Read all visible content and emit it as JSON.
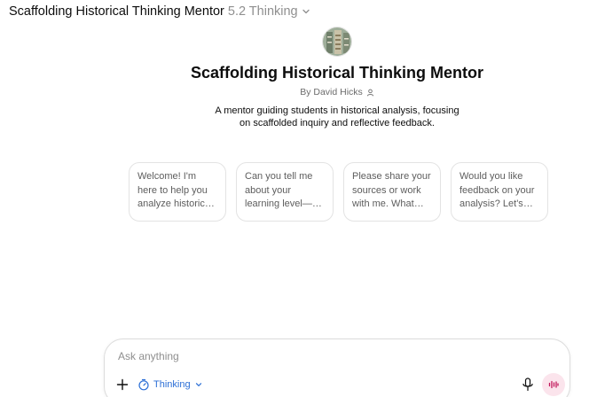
{
  "header": {
    "title": "Scaffolding Historical Thinking Mentor",
    "model": "5.2 Thinking",
    "chevron_icon": "chevron-down-icon"
  },
  "gpt": {
    "avatar_icon": "gpt-avatar-image",
    "title": "Scaffolding Historical Thinking Mentor",
    "author": "By David Hicks",
    "author_icon": "person-icon",
    "description": "A mentor guiding students in historical analysis, focusing on scaffolded inquiry and reflective feedback."
  },
  "starters": [
    {
      "text": "Welcome! I'm here to help you analyze historical sources..."
    },
    {
      "text": "Can you tell me about your learning level—are you in..."
    },
    {
      "text": "Please share your sources or work with me. What do..."
    },
    {
      "text": "Would you like feedback on your analysis? Let's se..."
    }
  ],
  "composer": {
    "placeholder": "Ask anything",
    "mode_label": "Thinking",
    "plus_icon": "plus-icon",
    "mode_icon": "timer-icon",
    "mic_icon": "microphone-icon",
    "voice_icon": "voice-waveform-icon"
  },
  "colors": {
    "accent": "#2c6fd6",
    "voice_bg": "#fbe4ec",
    "voice_fg": "#c2185b"
  }
}
